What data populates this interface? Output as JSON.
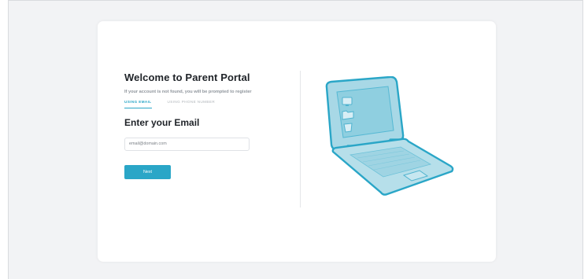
{
  "login": {
    "title": "Welcome to Parent Portal",
    "subtitle": "If your account is not found, you will be prompted to register",
    "tabs": [
      {
        "label": "USING EMAIL",
        "active": true
      },
      {
        "label": "USING PHONE NUMBER",
        "active": false
      }
    ],
    "heading": "Enter your Email",
    "email_placeholder": "email@domain.com",
    "email_value": "",
    "next_label": "Next"
  },
  "illustration": {
    "icon": "laptop-icon"
  },
  "colors": {
    "accent": "#2aa6c7",
    "background": "#f2f3f5",
    "card": "#ffffff",
    "text": "#1f2328",
    "muted": "#8f959c"
  }
}
